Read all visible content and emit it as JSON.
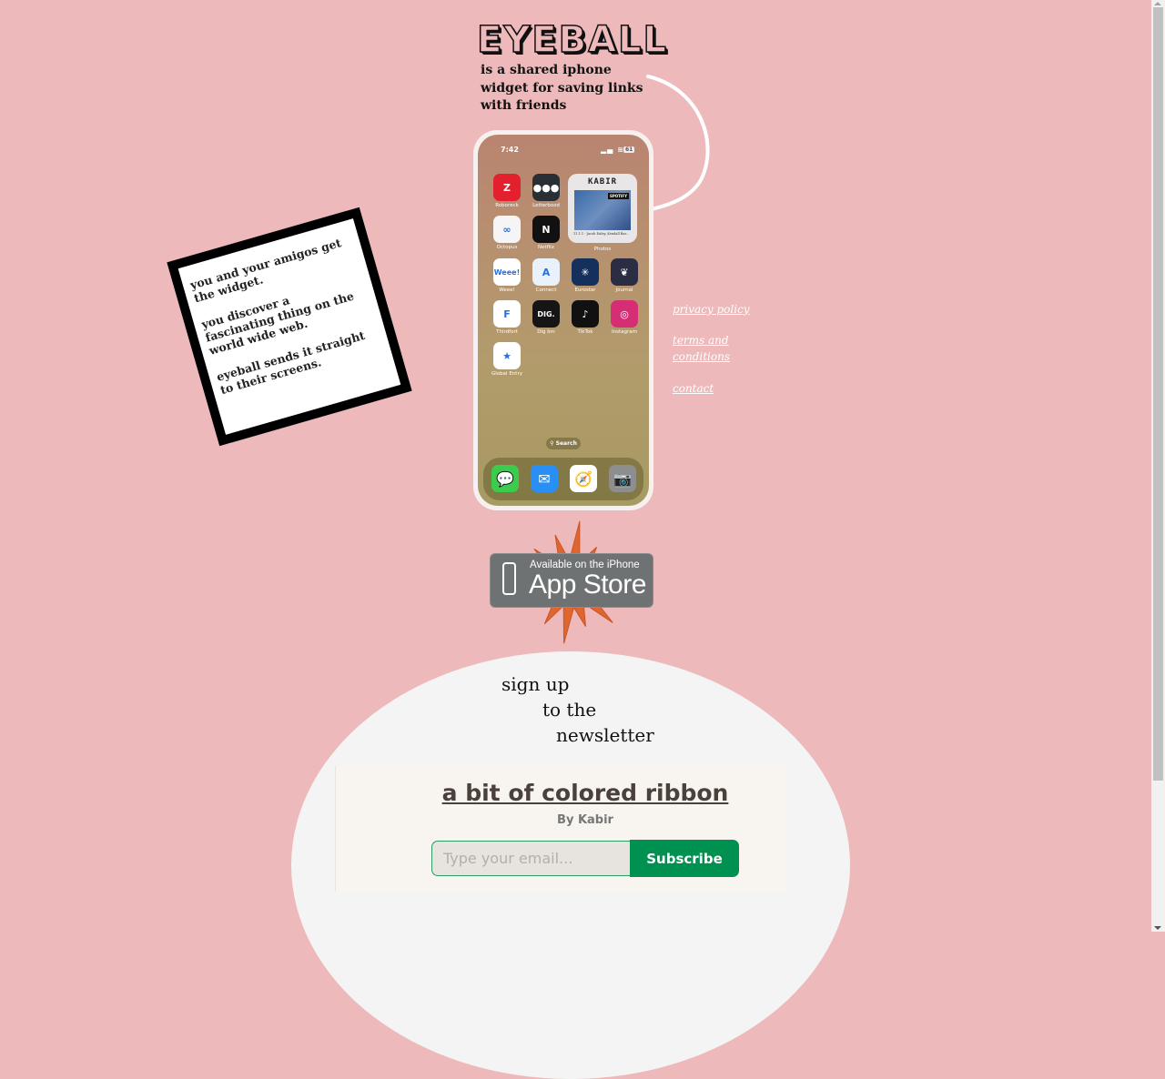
{
  "header": {
    "logo": "EYEBALL",
    "tagline": "is a shared iphone widget for saving links with friends"
  },
  "phone": {
    "time": "7:42",
    "battery": "61",
    "widget": {
      "title": "KABIR",
      "badge": "SPOTIFY",
      "caption": "11.1.1 - Jacob Daley, Kendall Bar...",
      "label": "Photos"
    },
    "apps": [
      {
        "name": "Roboreck",
        "icon": "roborock-icon",
        "color": "#e3202d",
        "glyph": "Z"
      },
      {
        "name": "Letterboxd",
        "icon": "letterboxd-icon",
        "color": "#2a2f35",
        "glyph": "●●●"
      },
      {
        "name": "Octopus",
        "icon": "octopus-icon",
        "color": "#f5f5f5",
        "glyph": "∞"
      },
      {
        "name": "Netflix",
        "icon": "netflix-icon",
        "color": "#111111",
        "glyph": "N"
      },
      {
        "name": "Weee!",
        "icon": "weee-icon",
        "color": "#ffffff",
        "glyph": "Weee!"
      },
      {
        "name": "Connect",
        "icon": "app-store-connect-icon",
        "color": "#e9f1fb",
        "glyph": "A"
      },
      {
        "name": "Eurostar",
        "icon": "eurostar-icon",
        "color": "#15305c",
        "glyph": "✳"
      },
      {
        "name": "Journal",
        "icon": "journal-icon",
        "color": "#2b2d43",
        "glyph": "❦"
      },
      {
        "name": "Thirdfort",
        "icon": "thirdfort-icon",
        "color": "#ffffff",
        "glyph": "F"
      },
      {
        "name": "Dig Inn",
        "icon": "dig-inn-icon",
        "color": "#151515",
        "glyph": "DIG."
      },
      {
        "name": "TikTok",
        "icon": "tiktok-icon",
        "color": "#111111",
        "glyph": "♪"
      },
      {
        "name": "Instagram",
        "icon": "instagram-icon",
        "color": "#d62e75",
        "glyph": "◎"
      },
      {
        "name": "Global Entry",
        "icon": "global-entry-icon",
        "color": "#ffffff",
        "glyph": "★"
      }
    ],
    "search_label": "Search",
    "dock": [
      {
        "name": "Messages",
        "icon": "messages-icon",
        "color": "#3ccb4c",
        "glyph": "💬"
      },
      {
        "name": "Mail",
        "icon": "mail-icon",
        "color": "#2a8ff5",
        "glyph": "✉"
      },
      {
        "name": "Safari",
        "icon": "safari-icon",
        "color": "#ffffff",
        "glyph": "🧭"
      },
      {
        "name": "Camera",
        "icon": "camera-icon",
        "color": "#8e8e8e",
        "glyph": "📷"
      }
    ]
  },
  "note": {
    "paragraphs": [
      "you and your amigos get the widget.",
      "you discover a fascinating thing on the world wide web.",
      "eyeball sends it straight to their screens."
    ]
  },
  "links": {
    "privacy": "privacy policy",
    "terms": "terms and conditions",
    "contact": "contact"
  },
  "appstore": {
    "line1": "Available on the iPhone",
    "line2": "App Store"
  },
  "newsletter": {
    "heading_lines": [
      "sign up",
      "to the",
      "newsletter"
    ],
    "title": "a bit of colored ribbon",
    "byline": "By Kabir",
    "email_placeholder": "Type your email...",
    "email_value": "",
    "subscribe_label": "Subscribe"
  },
  "colors": {
    "background": "#edb9ba",
    "subscribe": "#00904f",
    "starburst": "#e0662f"
  }
}
